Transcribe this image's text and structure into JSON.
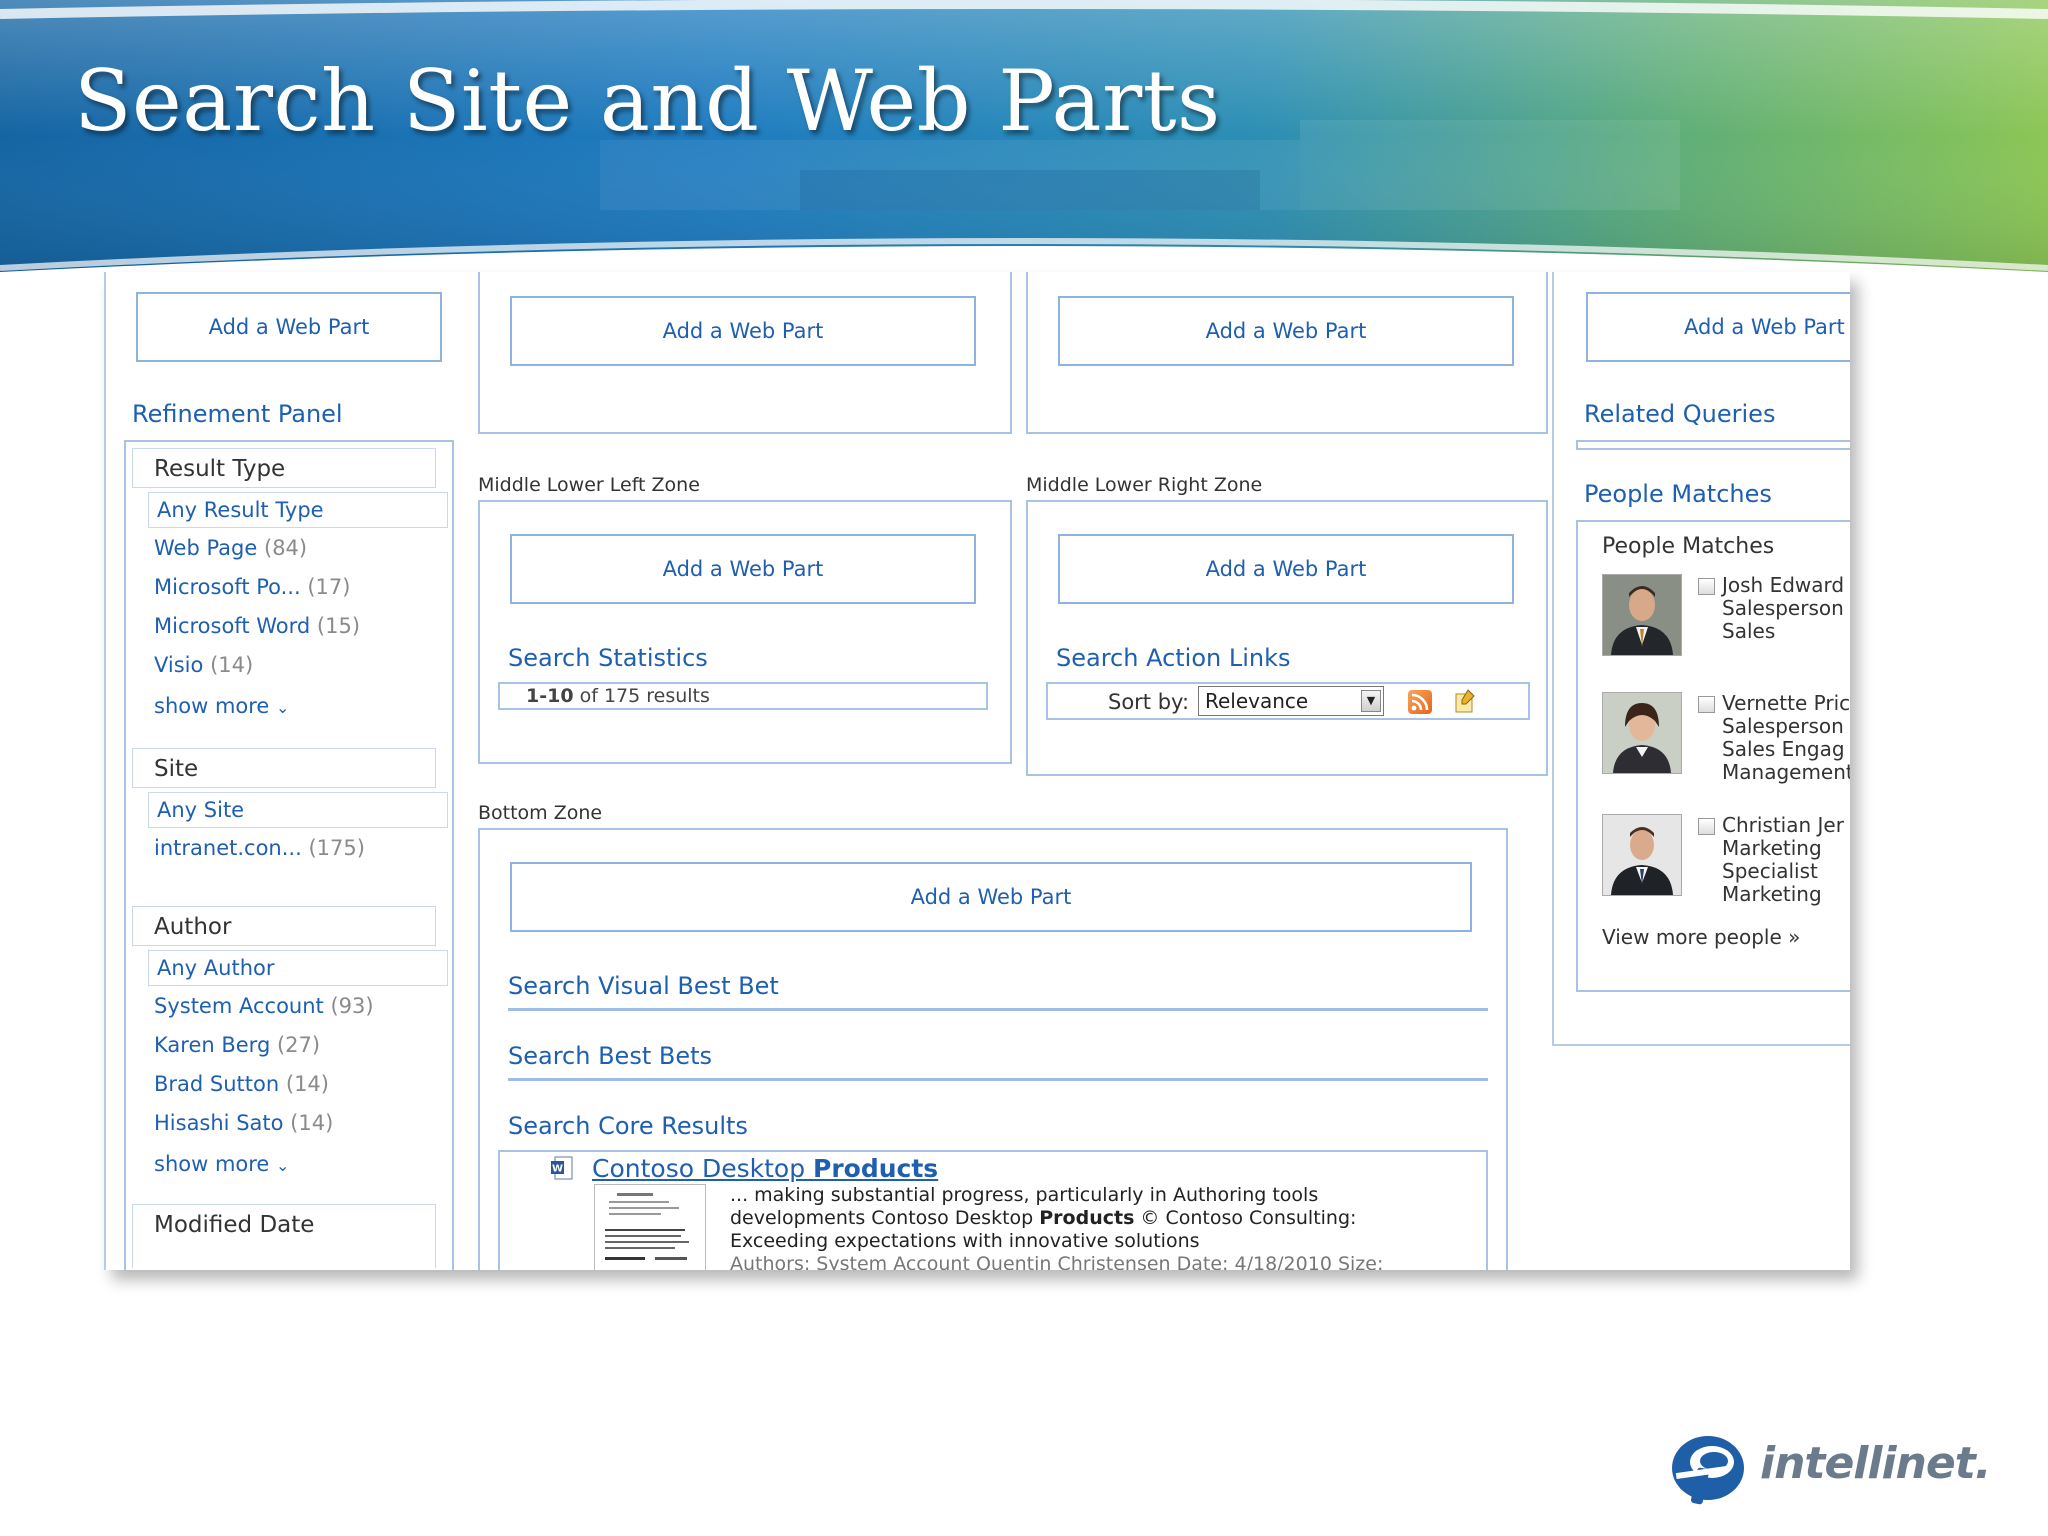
{
  "slide": {
    "title": "Search Site and Web Parts"
  },
  "ui": {
    "add_web_part": "Add a Web Part",
    "refinement": {
      "title": "Refinement Panel",
      "groups": [
        {
          "heading": "Result Type",
          "any": "Any Result Type",
          "items": [
            {
              "label": "Web Page",
              "count": "(84)"
            },
            {
              "label": "Microsoft Po...",
              "count": "(17)"
            },
            {
              "label": "Microsoft Word",
              "count": "(15)"
            },
            {
              "label": "Visio",
              "count": "(14)"
            }
          ],
          "more": "show more"
        },
        {
          "heading": "Site",
          "any": "Any Site",
          "items": [
            {
              "label": "intranet.con...",
              "count": "(175)"
            }
          ]
        },
        {
          "heading": "Author",
          "any": "Any Author",
          "items": [
            {
              "label": "System Account",
              "count": "(93)"
            },
            {
              "label": "Karen Berg",
              "count": "(27)"
            },
            {
              "label": "Brad Sutton",
              "count": "(14)"
            },
            {
              "label": "Hisashi Sato",
              "count": "(14)"
            }
          ],
          "more": "show more"
        },
        {
          "heading": "Modified Date"
        }
      ]
    },
    "zones": {
      "middle_lower_left": "Middle Lower Left Zone",
      "middle_lower_right": "Middle Lower Right Zone",
      "bottom": "Bottom Zone"
    },
    "search_statistics": {
      "title": "Search Statistics",
      "range": "1-10",
      "of_text": "of 175 results"
    },
    "search_action_links": {
      "title": "Search Action Links",
      "sort_label": "Sort by:",
      "sort_value": "Relevance"
    },
    "visual_best_bet": "Search Visual Best Bet",
    "best_bets": "Search Best Bets",
    "core_results": {
      "title": "Search Core Results",
      "result_title_plain": "Contoso Desktop ",
      "result_title_bold": "Products",
      "snippet_line1": "... making substantial progress, particularly in Authoring tools",
      "snippet_line2_pre": "developments Contoso Desktop ",
      "snippet_line2_bold": "Products",
      "snippet_line2_post": " © Contoso Consulting:",
      "snippet_line3": "Exceeding expectations with innovative solutions",
      "meta": "Authors: System Account Quentin Christensen   Date: 4/18/2010   Size:"
    },
    "related_queries": "Related Queries",
    "people_matches": {
      "title": "People Matches",
      "header": "People Matches",
      "people": [
        {
          "name": "Josh Edward",
          "lines": [
            "Salesperson",
            "Sales"
          ]
        },
        {
          "name": "Vernette Pric",
          "lines": [
            "Salesperson",
            "Sales Engag",
            "Management"
          ]
        },
        {
          "name": "Christian Jer",
          "lines": [
            "Marketing",
            "Specialist",
            "Marketing"
          ]
        }
      ],
      "view_more": "View more people »"
    }
  },
  "brand": {
    "logo_text": "intellinet."
  },
  "colors": {
    "link_blue": "#1f5fb0",
    "border_blue": "#8eb3df",
    "banner_blue": "#1b6fa8",
    "banner_green": "#7bc043"
  }
}
